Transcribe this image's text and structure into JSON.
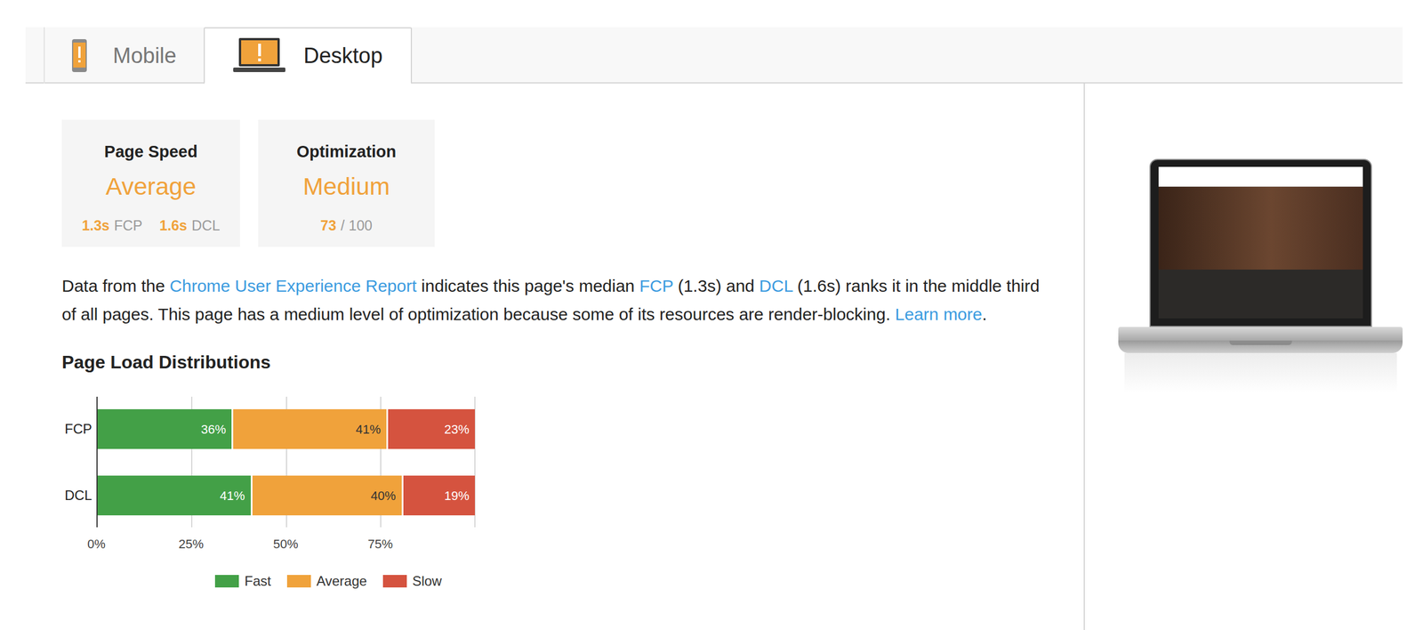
{
  "tabs": [
    {
      "label": "Mobile",
      "selected": false,
      "kind": "phone"
    },
    {
      "label": "Desktop",
      "selected": true,
      "kind": "laptop"
    }
  ],
  "cards": [
    {
      "title": "Page Speed",
      "value": "Average",
      "metrics": [
        {
          "value": "1.3s",
          "label": "FCP"
        },
        {
          "value": "1.6s",
          "label": "DCL"
        }
      ]
    },
    {
      "title": "Optimization",
      "value": "Medium",
      "metrics": [
        {
          "value": "73",
          "label": "/ 100"
        }
      ]
    }
  ],
  "summary": [
    {
      "text": "Data from the ",
      "link": false
    },
    {
      "text": "Chrome User Experience Report",
      "link": true
    },
    {
      "text": " indicates this page's median ",
      "link": false
    },
    {
      "text": "FCP",
      "link": true
    },
    {
      "text": " (1.3s) and ",
      "link": false
    },
    {
      "text": "DCL",
      "link": true
    },
    {
      "text": " (1.6s) ranks it in the middle third of all pages. This page has a medium level of optimization because some of its resources are render-blocking. ",
      "link": false
    },
    {
      "text": "Learn more",
      "link": true
    },
    {
      "text": ".",
      "link": false
    }
  ],
  "chart": {
    "title": "Page Load Distributions",
    "rows": [
      {
        "label": "FCP",
        "values": [
          36,
          41,
          23
        ],
        "texts": [
          "36%",
          "41%",
          "23%"
        ]
      },
      {
        "label": "DCL",
        "values": [
          41,
          40,
          19
        ],
        "texts": [
          "41%",
          "40%",
          "19%"
        ]
      }
    ],
    "ticks": [
      {
        "label": "0%",
        "value": 0
      },
      {
        "label": "25%",
        "value": 25
      },
      {
        "label": "50%",
        "value": 50
      },
      {
        "label": "75%",
        "value": 75
      }
    ],
    "series": [
      {
        "label": "Fast",
        "color": "#43a047"
      },
      {
        "label": "Average",
        "color": "#f0a23b"
      },
      {
        "label": "Slow",
        "color": "#d5533f"
      }
    ]
  }
}
